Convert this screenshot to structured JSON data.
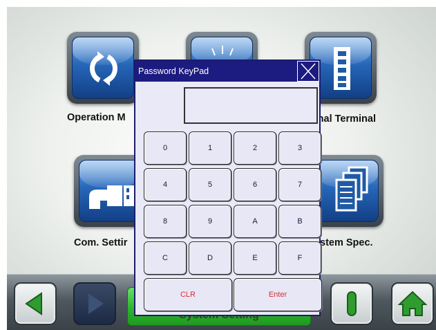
{
  "menu": {
    "tiles": [
      {
        "label": "Operation M",
        "icon": "refresh-arrows-icon"
      },
      {
        "label": "",
        "icon": "starburst-icon"
      },
      {
        "label": "rnal Terminal",
        "icon": "terminal-strip-icon"
      },
      {
        "label": "Com. Settir",
        "icon": "connector-plug-icon"
      },
      {
        "label": "stem Spec.",
        "icon": "document-stack-icon"
      }
    ]
  },
  "bottom_bar": {
    "back_icon": "arrow-left-icon",
    "forward_icon": "arrow-right-icon",
    "system_setting_label": "System Setting",
    "io_icon": "power-bar-icon",
    "home_icon": "home-icon"
  },
  "keypad": {
    "title": "Password KeyPad",
    "close_icon": "close-icon",
    "display_value": "",
    "keys": [
      "0",
      "1",
      "2",
      "3",
      "4",
      "5",
      "6",
      "7",
      "8",
      "9",
      "A",
      "B",
      "C",
      "D",
      "E",
      "F"
    ],
    "clear_label": "CLR",
    "enter_label": "Enter"
  },
  "colors": {
    "tile_blue": "#2666b8",
    "dialog_title": "#1b1b80",
    "action_red": "#d43030",
    "setting_green": "#2fb32f"
  }
}
